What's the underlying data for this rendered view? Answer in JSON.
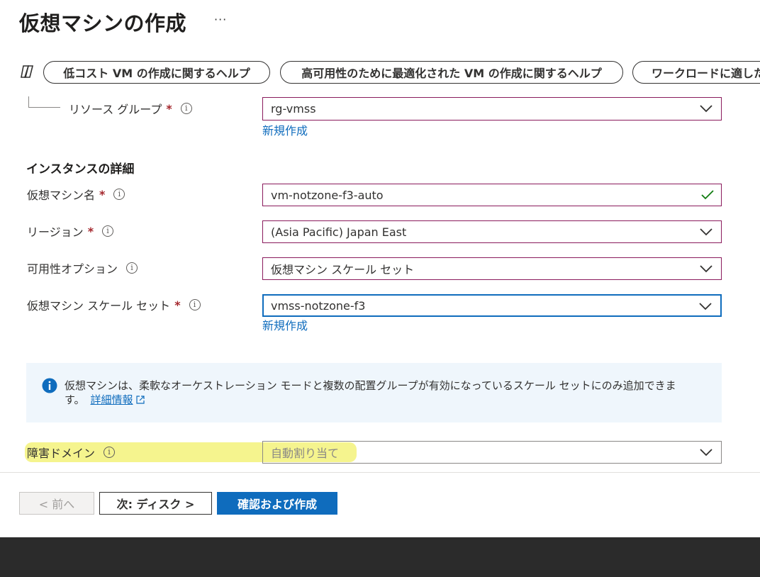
{
  "header": {
    "title": "仮想マシンの作成",
    "more_label": "···"
  },
  "copilot": {
    "icon": "copilot-icon",
    "suggestions": [
      "低コスト VM の作成に関するヘルプ",
      "高可用性のために最適化された VM の作成に関するヘルプ",
      "ワークロードに適した"
    ]
  },
  "form": {
    "resource_group": {
      "label": "リソース グループ",
      "value": "rg-vmss",
      "create_new": "新規作成"
    },
    "instance_details_heading": "インスタンスの詳細",
    "vm_name": {
      "label": "仮想マシン名",
      "value": "vm-notzone-f3-auto"
    },
    "region": {
      "label": "リージョン",
      "value": "(Asia Pacific) Japan East"
    },
    "availability_option": {
      "label": "可用性オプション",
      "value": "仮想マシン スケール セット"
    },
    "scale_set": {
      "label": "仮想マシン スケール セット",
      "value": "vmss-notzone-f3",
      "create_new": "新規作成"
    },
    "info_message": {
      "text": "仮想マシンは、柔軟なオーケストレーション モードと複数の配置グループが有効になっているスケール セットにのみ追加できます。",
      "link": "詳細情報"
    },
    "fault_domain": {
      "label": "障害ドメイン",
      "value": "自動割り当て"
    },
    "required_mark": "*",
    "info_glyph": "i"
  },
  "footer": {
    "prev_label": "< 前へ",
    "next_label": "次: ディスク >",
    "create_label": "確認および作成"
  },
  "colors": {
    "accent": "#0f6cbd",
    "required": "#a4262c",
    "highlight": "#f3f27a",
    "valid_check": "#107c10"
  }
}
